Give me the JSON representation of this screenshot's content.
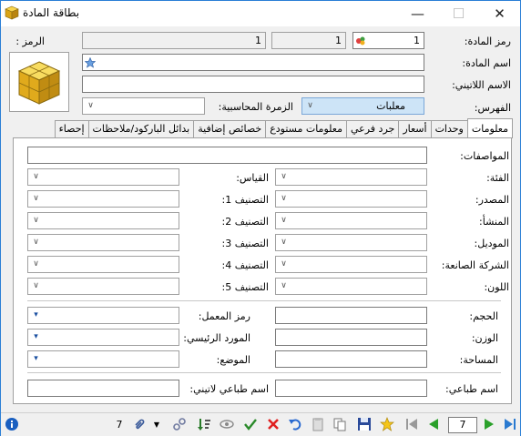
{
  "window": {
    "title": "بطاقة المادة",
    "min_glyph": "—",
    "max_glyph": "☐",
    "close_glyph": "✕"
  },
  "header": {
    "code_label": "رمز المادة:",
    "code_value": "1",
    "code_part2": "1",
    "code_part3": "1",
    "symbol_label": "الرمز :",
    "name_label": "اسم المادة:",
    "name_value": "",
    "latin_label": "الاسم اللاتيني:",
    "latin_value": "",
    "index_label": "الفهرس:",
    "index_value": "معلبات",
    "acct_group_label": "الزمرة المحاسبية:",
    "acct_group_value": ""
  },
  "tabs": [
    {
      "label": "معلومات",
      "active": true
    },
    {
      "label": "وحدات",
      "active": false
    },
    {
      "label": "أسعار",
      "active": false
    },
    {
      "label": "جرد فرعي",
      "active": false
    },
    {
      "label": "معلومات مستودع",
      "active": false
    },
    {
      "label": "خصائص إضافية",
      "active": false
    },
    {
      "label": "بدائل الباركود/ملاحظات",
      "active": false
    },
    {
      "label": "إحصاء",
      "active": false
    }
  ],
  "info": {
    "specs_label": "المواصفات:",
    "right_col": [
      {
        "label": "الفئة:",
        "value": ""
      },
      {
        "label": "المصدر:",
        "value": ""
      },
      {
        "label": "المنشأ:",
        "value": ""
      },
      {
        "label": "الموديل:",
        "value": ""
      },
      {
        "label": "الشركة الصانعة:",
        "value": ""
      },
      {
        "label": "اللون:",
        "value": ""
      }
    ],
    "left_col": [
      {
        "label": "القياس:",
        "value": ""
      },
      {
        "label": "التصنيف 1:",
        "value": ""
      },
      {
        "label": "التصنيف 2:",
        "value": ""
      },
      {
        "label": "التصنيف 3:",
        "value": ""
      },
      {
        "label": "التصنيف 4:",
        "value": ""
      },
      {
        "label": "التصنيف 5:",
        "value": ""
      }
    ],
    "volume_label": "الحجم:",
    "weight_label": "الوزن:",
    "area_label": "المساحة:",
    "lab_code_label": "رمز المعمل:",
    "main_supplier_label": "المورد الرئيسي:",
    "position_label": "الموضع:",
    "print_name_label": "اسم طباعي:",
    "print_latin_label": "اسم طباعي لاتيني:"
  },
  "statusbar": {
    "count": "7",
    "page": "7"
  }
}
